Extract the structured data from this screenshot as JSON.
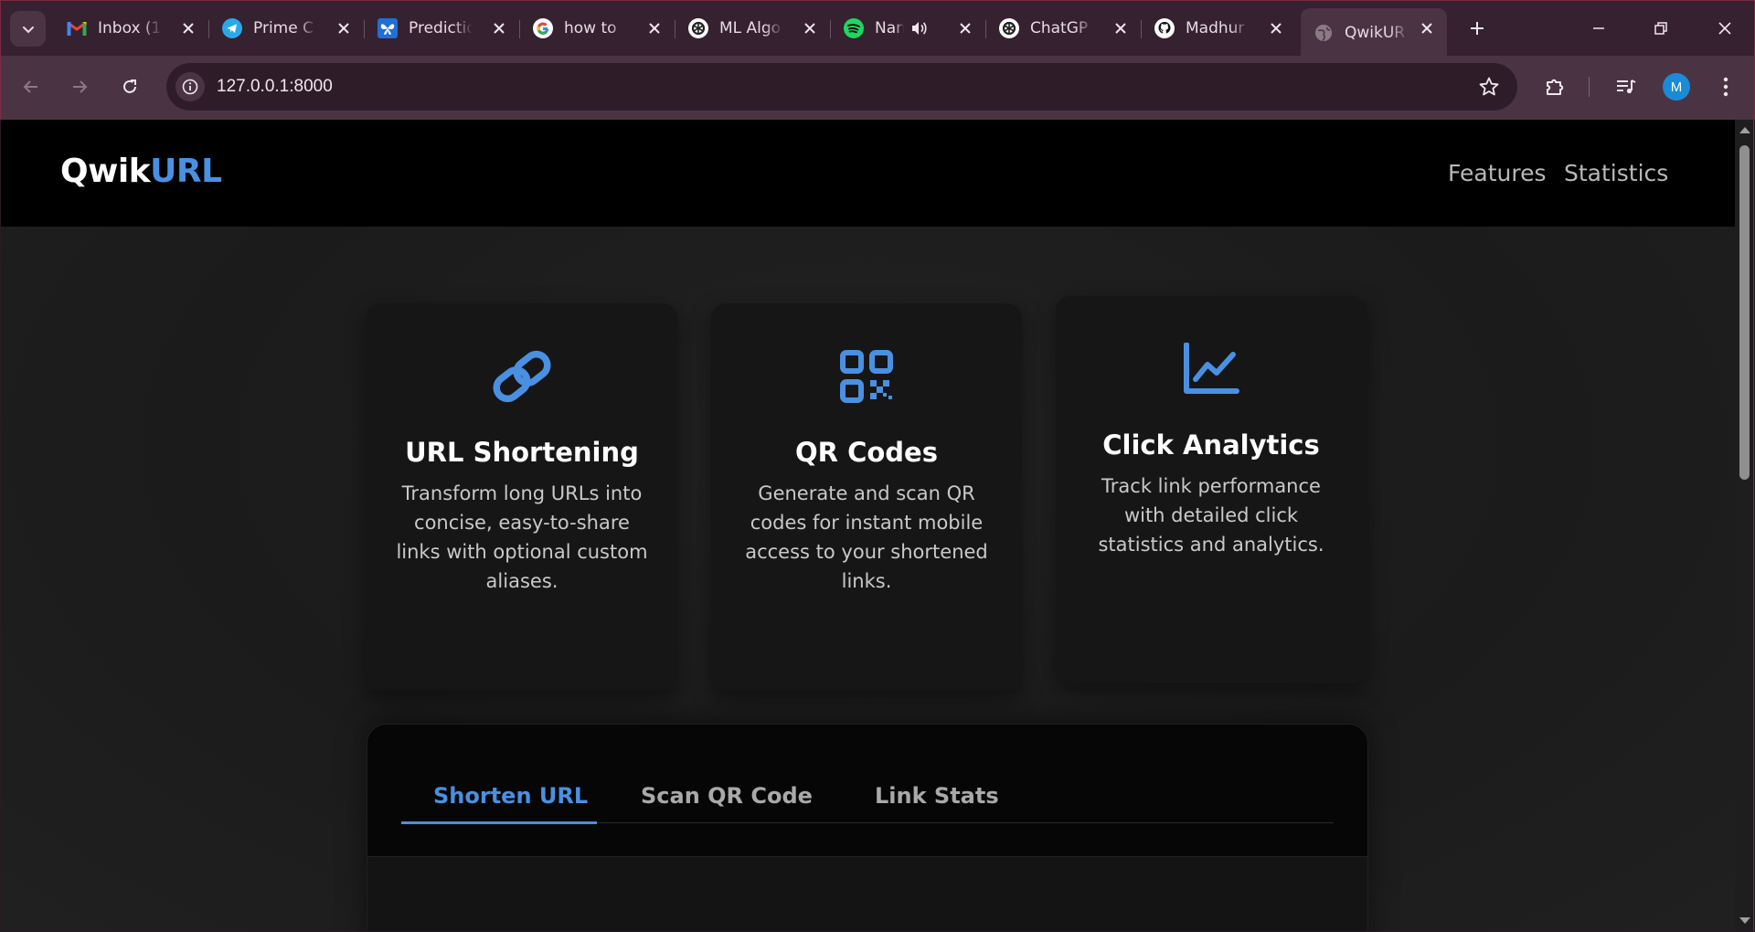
{
  "browser": {
    "tabs": [
      {
        "title": "Inbox (1",
        "icon": "gmail-icon"
      },
      {
        "title": "Prime C",
        "icon": "telegram-icon"
      },
      {
        "title": "Predictio",
        "icon": "butterfly-icon"
      },
      {
        "title": "how to",
        "icon": "google-icon"
      },
      {
        "title": "ML Algo",
        "icon": "openai-icon"
      },
      {
        "title": "Nan",
        "icon": "spotify-icon"
      },
      {
        "title": "ChatGP",
        "icon": "openai-icon"
      },
      {
        "title": "Madhur",
        "icon": "github-icon"
      },
      {
        "title": "QwikUR",
        "icon": "globe-icon"
      }
    ],
    "active_tab_index": 8,
    "url": "127.0.0.1:8000",
    "profile_initial": "M",
    "colors": {
      "frame": "#35212f",
      "toolbar": "#4a3443",
      "omnibox": "#2e1d29",
      "avatar": "#1a8bd6"
    }
  },
  "site": {
    "brand": {
      "part1": "Qwik",
      "part2": "URL"
    },
    "nav": {
      "features": "Features",
      "statistics": "Statistics"
    },
    "colors": {
      "accent": "#4a90e2",
      "nav_bg": "#000000",
      "card_bg": "#161616"
    },
    "features": [
      {
        "icon": "link-icon",
        "title": "URL Shortening",
        "description": "Transform long URLs into concise, easy-to-share links with optional custom aliases."
      },
      {
        "icon": "qr-code-icon",
        "title": "QR Codes",
        "description": "Generate and scan QR codes for instant mobile access to your shortened links."
      },
      {
        "icon": "line-chart-icon",
        "title": "Click Analytics",
        "description": "Track link performance with detailed click statistics and analytics."
      }
    ],
    "panel": {
      "tabs": [
        "Shorten URL",
        "Scan QR Code",
        "Link Stats"
      ],
      "active_tab": "Shorten URL"
    }
  }
}
